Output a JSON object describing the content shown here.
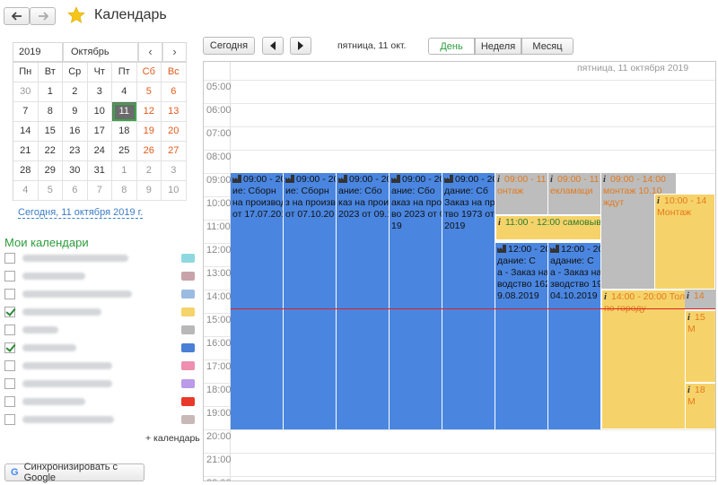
{
  "header": {
    "title": "Календарь",
    "back_icon": "arrow-left-icon",
    "forward_icon": "arrow-right-icon",
    "favorite_icon": "star-icon"
  },
  "mini_calendar": {
    "year": "2019",
    "month": "Октябрь",
    "weekdays": [
      "Пн",
      "Вт",
      "Ср",
      "Чт",
      "Пт",
      "Сб",
      "Вс"
    ],
    "weeks": [
      [
        "30",
        "1",
        "2",
        "3",
        "4",
        "5",
        "6"
      ],
      [
        "7",
        "8",
        "9",
        "10",
        "11",
        "12",
        "13"
      ],
      [
        "14",
        "15",
        "16",
        "17",
        "18",
        "19",
        "20"
      ],
      [
        "21",
        "22",
        "23",
        "24",
        "25",
        "26",
        "27"
      ],
      [
        "28",
        "29",
        "30",
        "31",
        "1",
        "2",
        "3"
      ],
      [
        "4",
        "5",
        "6",
        "7",
        "8",
        "9",
        "10"
      ]
    ],
    "today_link": "Сегодня, 11 октября 2019 г."
  },
  "my_calendars": {
    "heading": "Мои календари",
    "items": [
      {
        "checked": false,
        "color": "#8fd8e0"
      },
      {
        "checked": false,
        "color": "#c9a3aa"
      },
      {
        "checked": false,
        "color": "#9bbbe0"
      },
      {
        "checked": true,
        "color": "#f5d36b"
      },
      {
        "checked": false,
        "color": "#b8b8b8"
      },
      {
        "checked": true,
        "color": "#4a7fd6"
      },
      {
        "checked": false,
        "color": "#ee8fb0"
      },
      {
        "checked": false,
        "color": "#b99be8"
      },
      {
        "checked": false,
        "color": "#e83a2a"
      },
      {
        "checked": false,
        "color": "#c9b8b8"
      }
    ],
    "add_label": "+ календарь"
  },
  "sync_button": "Синхронизировать с Google",
  "toolbar": {
    "today": "Сегодня",
    "date": "пятница, 11 окт.",
    "views": [
      "День",
      "Неделя",
      "Месяц"
    ],
    "active_view": "День"
  },
  "day_view": {
    "date_header": "пятница, 11 октября 2019",
    "hours": [
      "05:00",
      "06:00",
      "07:00",
      "08:00",
      "09:00",
      "10:00",
      "11:00",
      "12:00",
      "13:00",
      "14:00",
      "15:00",
      "16:00",
      "17:00",
      "18:00",
      "19:00",
      "20:00",
      "21:00",
      "22:00"
    ],
    "events": {
      "b1": [
        "09:00 - 20",
        "ие: Сборн",
        "на производ",
        "от 17.07.2019"
      ],
      "b2": [
        "09:00 - 20",
        "ие: Сборн",
        "з на произво",
        "от 07.10.20"
      ],
      "b3": [
        "09:00 - 20",
        "ание: Сбо",
        "каз на прои",
        "2023 от 09.1"
      ],
      "b4": [
        "09:00 - 20",
        "ание: Сбо",
        "аказ на про",
        "во 2023 от 0",
        "19"
      ],
      "b5": [
        "09:00 - 20",
        "дание: Сб",
        "Заказ на про",
        "тво 1973 от",
        "2019"
      ],
      "b6": [
        "12:00 - 20",
        "дание: С",
        "а - Заказ на",
        "водство 162",
        "9.08.2019"
      ],
      "b7": [
        "12:00 - 20",
        "адание: С",
        "а - Заказ на",
        "зводство 19",
        "04.10.2019"
      ],
      "g1": [
        "09:00 - 11",
        "онтаж"
      ],
      "g2": [
        "09:00 - 11",
        "екламаци"
      ],
      "g3": [
        "09:00 - 14:00",
        "монтаж 10.10",
        "ждут"
      ],
      "g4": [
        "14"
      ],
      "y1": [
        "11:00 - 12:00 самовыв"
      ],
      "y2": [
        "10:00 - 14",
        "Монтаж"
      ],
      "y3": [
        "14:00 - 20:00 Тол",
        "по городу"
      ],
      "y4": [
        "15",
        "М"
      ],
      "y5": [
        "18",
        "М"
      ]
    }
  }
}
